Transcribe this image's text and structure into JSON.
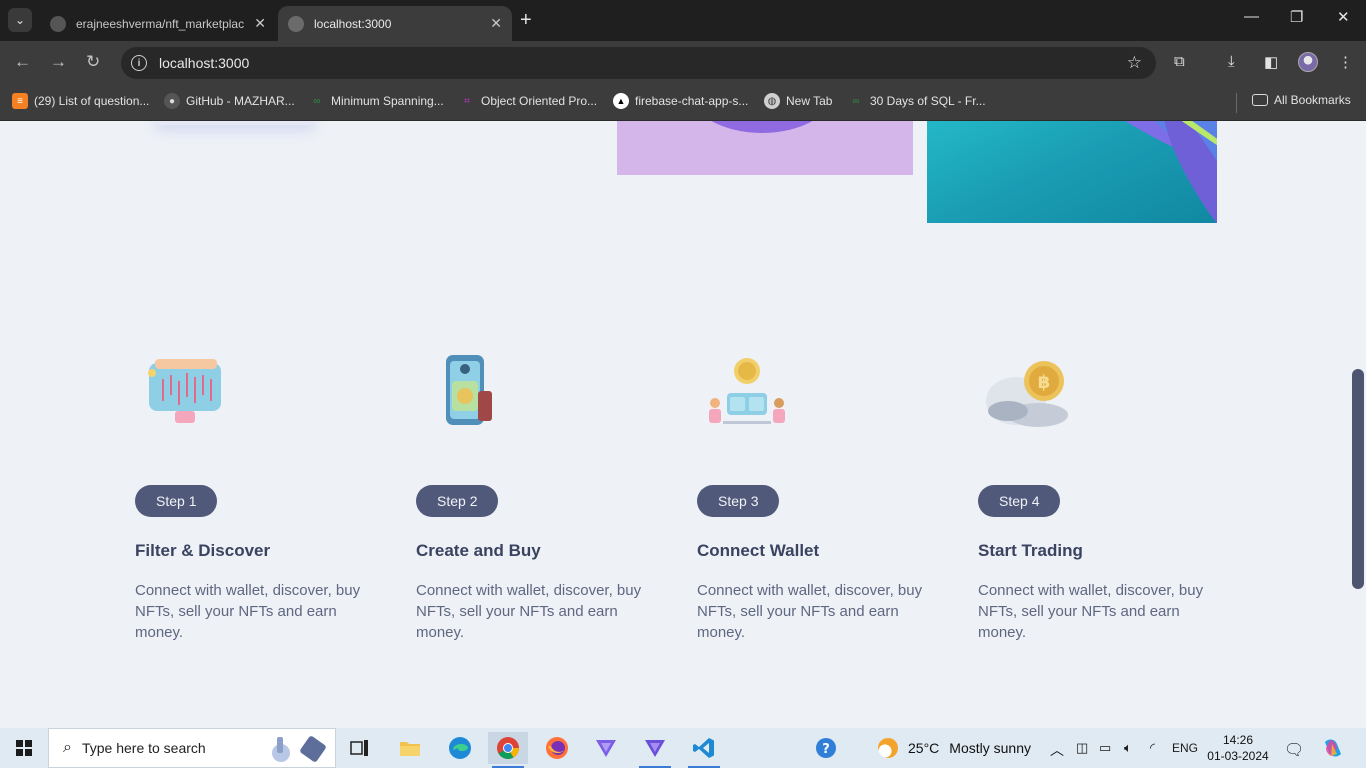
{
  "browser": {
    "tabs": [
      {
        "title": "erajneeshverma/nft_marketplace",
        "active": false
      },
      {
        "title": "localhost:3000",
        "active": true
      }
    ],
    "url": "localhost:3000",
    "bookmarks": [
      {
        "label": "(29) List of question...",
        "icon": "stackoverflow-icon"
      },
      {
        "label": "GitHub - MAZHAR...",
        "icon": "github-icon"
      },
      {
        "label": "Minimum Spanning...",
        "icon": "geeksforgeeks-icon"
      },
      {
        "label": "Object Oriented Pro...",
        "icon": "code-icon"
      },
      {
        "label": "firebase-chat-app-s...",
        "icon": "vercel-icon"
      },
      {
        "label": "New Tab",
        "icon": "globe-icon"
      },
      {
        "label": "30 Days of SQL - Fr...",
        "icon": "geeksforgeeks-icon"
      }
    ],
    "all_bookmarks": "All Bookmarks"
  },
  "steps": [
    {
      "badge": "Step 1",
      "title": "Filter & Discover",
      "description": "Connect with wallet, discover, buy NFTs, sell your NFTs and earn money.",
      "illustration": "chart-monitor-icon"
    },
    {
      "badge": "Step 2",
      "title": "Create and Buy",
      "description": "Connect with wallet, discover, buy NFTs, sell your NFTs and earn money.",
      "illustration": "phone-card-icon"
    },
    {
      "badge": "Step 3",
      "title": "Connect Wallet",
      "description": "Connect with wallet, discover, buy NFTs, sell your NFTs and earn money.",
      "illustration": "meeting-coin-icon"
    },
    {
      "badge": "Step 4",
      "title": "Start Trading",
      "description": "Connect with wallet, discover, buy NFTs, sell your NFTs and earn money.",
      "illustration": "bitcoin-rock-icon"
    }
  ],
  "taskbar": {
    "search_placeholder": "Type here to search",
    "weather_temp": "25°C",
    "weather_text": "Mostly sunny",
    "language": "ENG",
    "time": "14:26",
    "date": "01-03-2024"
  },
  "colors": {
    "page_bg": "#eef1f6",
    "badge_bg": "#505979",
    "title": "#3a4360",
    "text": "#5f6781"
  }
}
